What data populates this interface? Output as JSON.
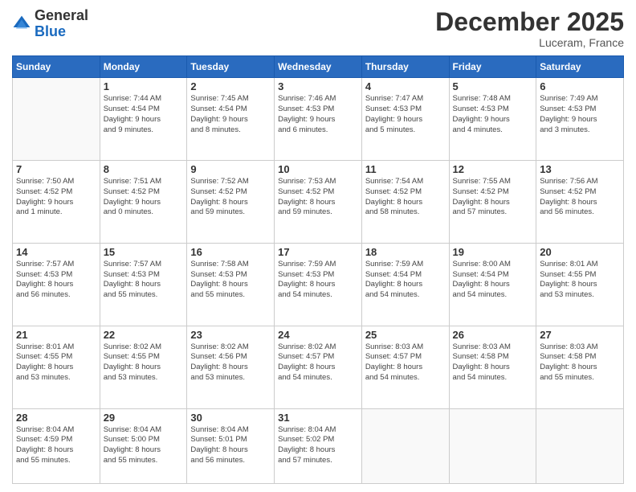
{
  "header": {
    "logo_general": "General",
    "logo_blue": "Blue",
    "month_title": "December 2025",
    "location": "Luceram, France"
  },
  "weekdays": [
    "Sunday",
    "Monday",
    "Tuesday",
    "Wednesday",
    "Thursday",
    "Friday",
    "Saturday"
  ],
  "weeks": [
    [
      {
        "day": "",
        "info": ""
      },
      {
        "day": "1",
        "info": "Sunrise: 7:44 AM\nSunset: 4:54 PM\nDaylight: 9 hours\nand 9 minutes."
      },
      {
        "day": "2",
        "info": "Sunrise: 7:45 AM\nSunset: 4:54 PM\nDaylight: 9 hours\nand 8 minutes."
      },
      {
        "day": "3",
        "info": "Sunrise: 7:46 AM\nSunset: 4:53 PM\nDaylight: 9 hours\nand 6 minutes."
      },
      {
        "day": "4",
        "info": "Sunrise: 7:47 AM\nSunset: 4:53 PM\nDaylight: 9 hours\nand 5 minutes."
      },
      {
        "day": "5",
        "info": "Sunrise: 7:48 AM\nSunset: 4:53 PM\nDaylight: 9 hours\nand 4 minutes."
      },
      {
        "day": "6",
        "info": "Sunrise: 7:49 AM\nSunset: 4:53 PM\nDaylight: 9 hours\nand 3 minutes."
      }
    ],
    [
      {
        "day": "7",
        "info": "Sunrise: 7:50 AM\nSunset: 4:52 PM\nDaylight: 9 hours\nand 1 minute."
      },
      {
        "day": "8",
        "info": "Sunrise: 7:51 AM\nSunset: 4:52 PM\nDaylight: 9 hours\nand 0 minutes."
      },
      {
        "day": "9",
        "info": "Sunrise: 7:52 AM\nSunset: 4:52 PM\nDaylight: 8 hours\nand 59 minutes."
      },
      {
        "day": "10",
        "info": "Sunrise: 7:53 AM\nSunset: 4:52 PM\nDaylight: 8 hours\nand 59 minutes."
      },
      {
        "day": "11",
        "info": "Sunrise: 7:54 AM\nSunset: 4:52 PM\nDaylight: 8 hours\nand 58 minutes."
      },
      {
        "day": "12",
        "info": "Sunrise: 7:55 AM\nSunset: 4:52 PM\nDaylight: 8 hours\nand 57 minutes."
      },
      {
        "day": "13",
        "info": "Sunrise: 7:56 AM\nSunset: 4:52 PM\nDaylight: 8 hours\nand 56 minutes."
      }
    ],
    [
      {
        "day": "14",
        "info": "Sunrise: 7:57 AM\nSunset: 4:53 PM\nDaylight: 8 hours\nand 56 minutes."
      },
      {
        "day": "15",
        "info": "Sunrise: 7:57 AM\nSunset: 4:53 PM\nDaylight: 8 hours\nand 55 minutes."
      },
      {
        "day": "16",
        "info": "Sunrise: 7:58 AM\nSunset: 4:53 PM\nDaylight: 8 hours\nand 55 minutes."
      },
      {
        "day": "17",
        "info": "Sunrise: 7:59 AM\nSunset: 4:53 PM\nDaylight: 8 hours\nand 54 minutes."
      },
      {
        "day": "18",
        "info": "Sunrise: 7:59 AM\nSunset: 4:54 PM\nDaylight: 8 hours\nand 54 minutes."
      },
      {
        "day": "19",
        "info": "Sunrise: 8:00 AM\nSunset: 4:54 PM\nDaylight: 8 hours\nand 54 minutes."
      },
      {
        "day": "20",
        "info": "Sunrise: 8:01 AM\nSunset: 4:55 PM\nDaylight: 8 hours\nand 53 minutes."
      }
    ],
    [
      {
        "day": "21",
        "info": "Sunrise: 8:01 AM\nSunset: 4:55 PM\nDaylight: 8 hours\nand 53 minutes."
      },
      {
        "day": "22",
        "info": "Sunrise: 8:02 AM\nSunset: 4:55 PM\nDaylight: 8 hours\nand 53 minutes."
      },
      {
        "day": "23",
        "info": "Sunrise: 8:02 AM\nSunset: 4:56 PM\nDaylight: 8 hours\nand 53 minutes."
      },
      {
        "day": "24",
        "info": "Sunrise: 8:02 AM\nSunset: 4:57 PM\nDaylight: 8 hours\nand 54 minutes."
      },
      {
        "day": "25",
        "info": "Sunrise: 8:03 AM\nSunset: 4:57 PM\nDaylight: 8 hours\nand 54 minutes."
      },
      {
        "day": "26",
        "info": "Sunrise: 8:03 AM\nSunset: 4:58 PM\nDaylight: 8 hours\nand 54 minutes."
      },
      {
        "day": "27",
        "info": "Sunrise: 8:03 AM\nSunset: 4:58 PM\nDaylight: 8 hours\nand 55 minutes."
      }
    ],
    [
      {
        "day": "28",
        "info": "Sunrise: 8:04 AM\nSunset: 4:59 PM\nDaylight: 8 hours\nand 55 minutes."
      },
      {
        "day": "29",
        "info": "Sunrise: 8:04 AM\nSunset: 5:00 PM\nDaylight: 8 hours\nand 55 minutes."
      },
      {
        "day": "30",
        "info": "Sunrise: 8:04 AM\nSunset: 5:01 PM\nDaylight: 8 hours\nand 56 minutes."
      },
      {
        "day": "31",
        "info": "Sunrise: 8:04 AM\nSunset: 5:02 PM\nDaylight: 8 hours\nand 57 minutes."
      },
      {
        "day": "",
        "info": ""
      },
      {
        "day": "",
        "info": ""
      },
      {
        "day": "",
        "info": ""
      }
    ]
  ]
}
